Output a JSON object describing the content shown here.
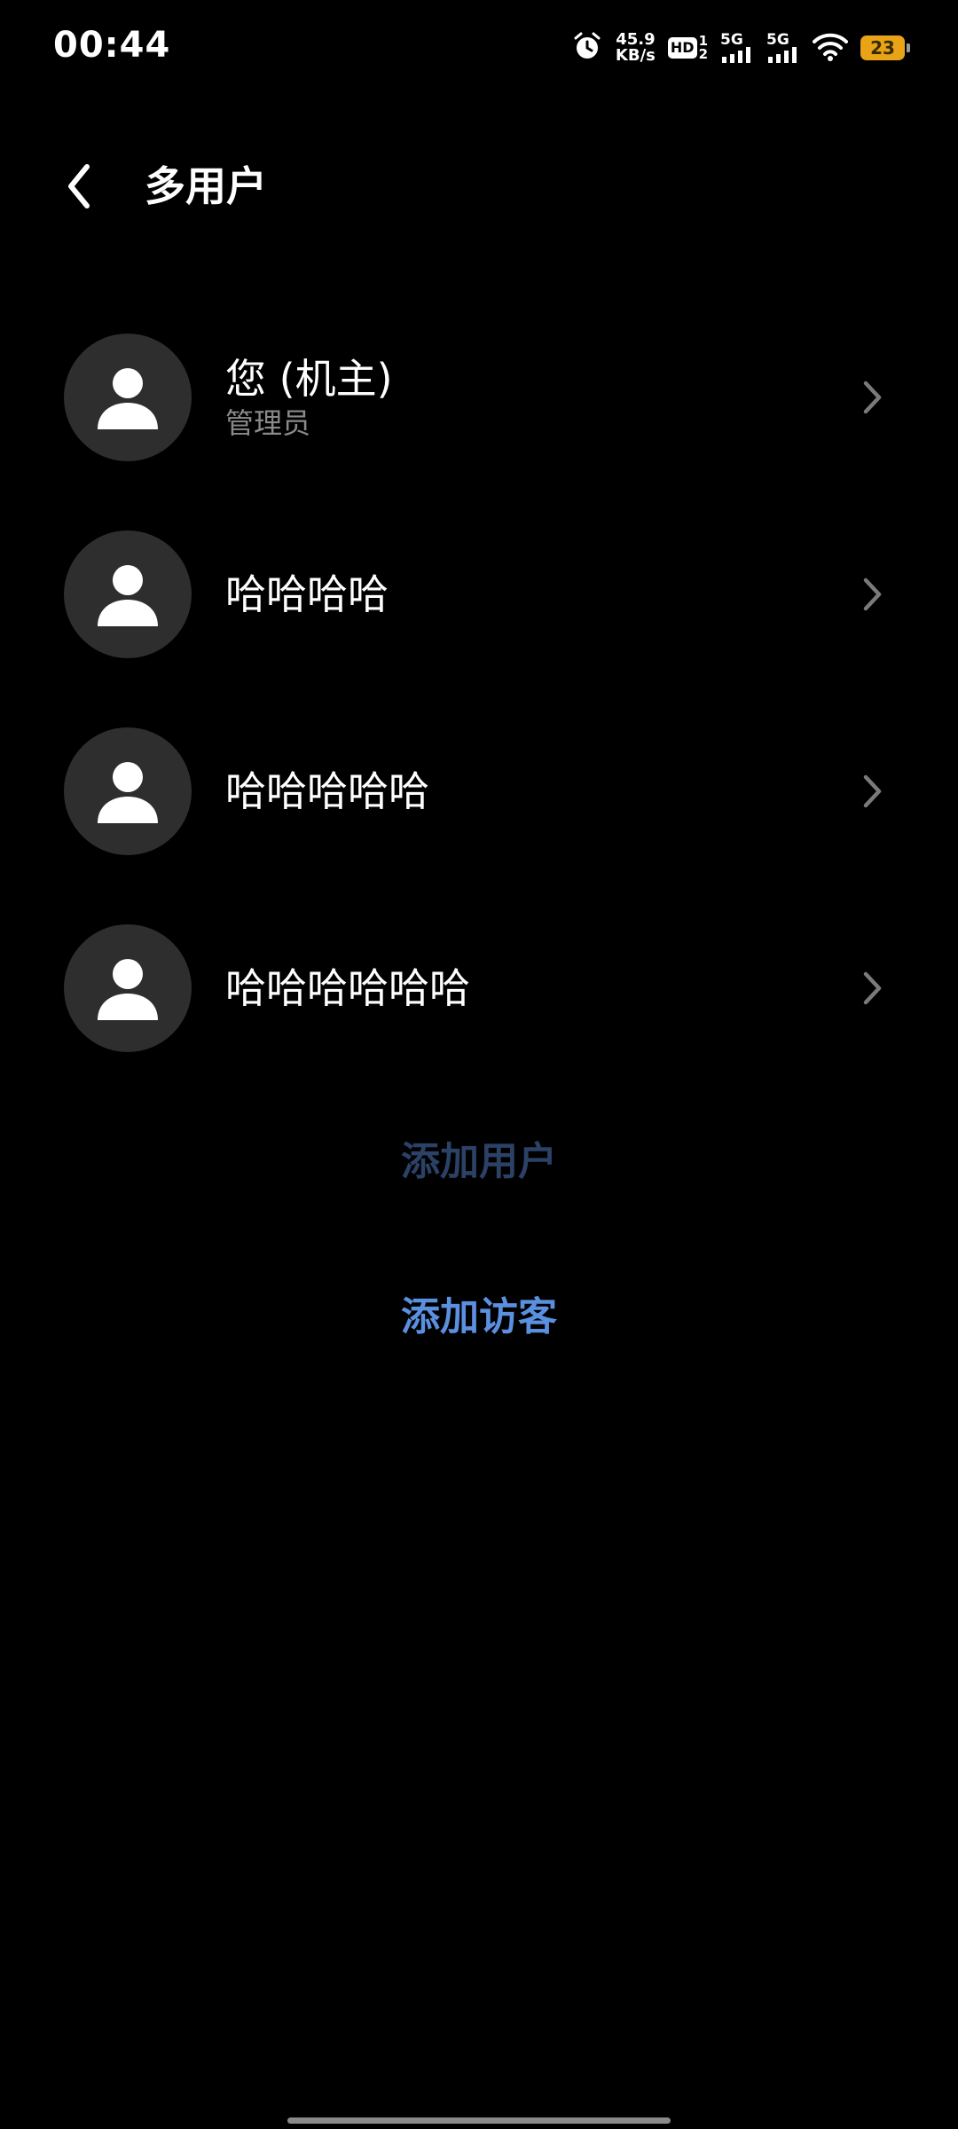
{
  "status_bar": {
    "time": "00:44",
    "net_speed_value": "45.9",
    "net_speed_unit": "KB/s",
    "hd_label": "HD",
    "hd_sub_top": "1",
    "hd_sub_bottom": "2",
    "signal1_label": "5G",
    "signal2_label": "5G",
    "battery_level": "23",
    "battery_color": "#e8a317"
  },
  "header": {
    "title": "多用户"
  },
  "users": [
    {
      "name": "您 (机主)",
      "role": "管理员"
    },
    {
      "name": "哈哈哈哈",
      "role": ""
    },
    {
      "name": "哈哈哈哈哈",
      "role": ""
    },
    {
      "name": "哈哈哈哈哈哈",
      "role": ""
    }
  ],
  "actions": {
    "add_user": "添加用户",
    "add_user_color": "#2c4166",
    "add_guest": "添加访客",
    "add_guest_color": "#5b8fe0"
  }
}
